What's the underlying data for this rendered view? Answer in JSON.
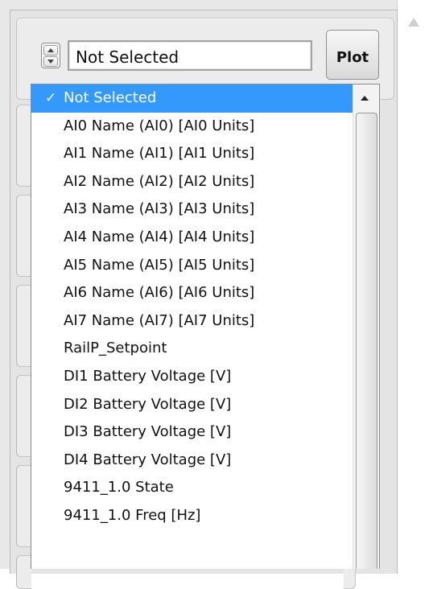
{
  "selector": {
    "value": "Not Selected"
  },
  "plot_button": {
    "label": "Plot"
  },
  "dropdown": {
    "check_mark": "✓",
    "items": [
      {
        "label": "Not Selected",
        "selected": true
      },
      {
        "label": "AI0 Name (AI0) [AI0 Units]",
        "selected": false
      },
      {
        "label": "AI1 Name (AI1) [AI1 Units]",
        "selected": false
      },
      {
        "label": "AI2 Name (AI2) [AI2 Units]",
        "selected": false
      },
      {
        "label": "AI3 Name (AI3) [AI3 Units]",
        "selected": false
      },
      {
        "label": "AI4 Name (AI4) [AI4 Units]",
        "selected": false
      },
      {
        "label": "AI5 Name (AI5) [AI5 Units]",
        "selected": false
      },
      {
        "label": "AI6 Name (AI6) [AI6 Units]",
        "selected": false
      },
      {
        "label": "AI7 Name (AI7) [AI7 Units]",
        "selected": false
      },
      {
        "label": "RailP_Setpoint",
        "selected": false
      },
      {
        "label": "DI1 Battery Voltage [V]",
        "selected": false
      },
      {
        "label": "DI2 Battery Voltage [V]",
        "selected": false
      },
      {
        "label": "DI3 Battery Voltage [V]",
        "selected": false
      },
      {
        "label": "DI4 Battery Voltage [V]",
        "selected": false
      },
      {
        "label": "9411_1.0 State",
        "selected": false
      },
      {
        "label": "9411_1.0 Freq [Hz]",
        "selected": false
      }
    ]
  },
  "colors": {
    "selection_highlight": "#3399ff",
    "panel_background": "#e8e8e8"
  },
  "icons": {
    "spinner_up": "triangle-up-icon",
    "spinner_down": "triangle-down-icon",
    "list_scroll_up": "scroll-up-arrow-icon",
    "page_scroll_up": "scroll-up-arrow-icon",
    "selected_check": "check-icon"
  }
}
